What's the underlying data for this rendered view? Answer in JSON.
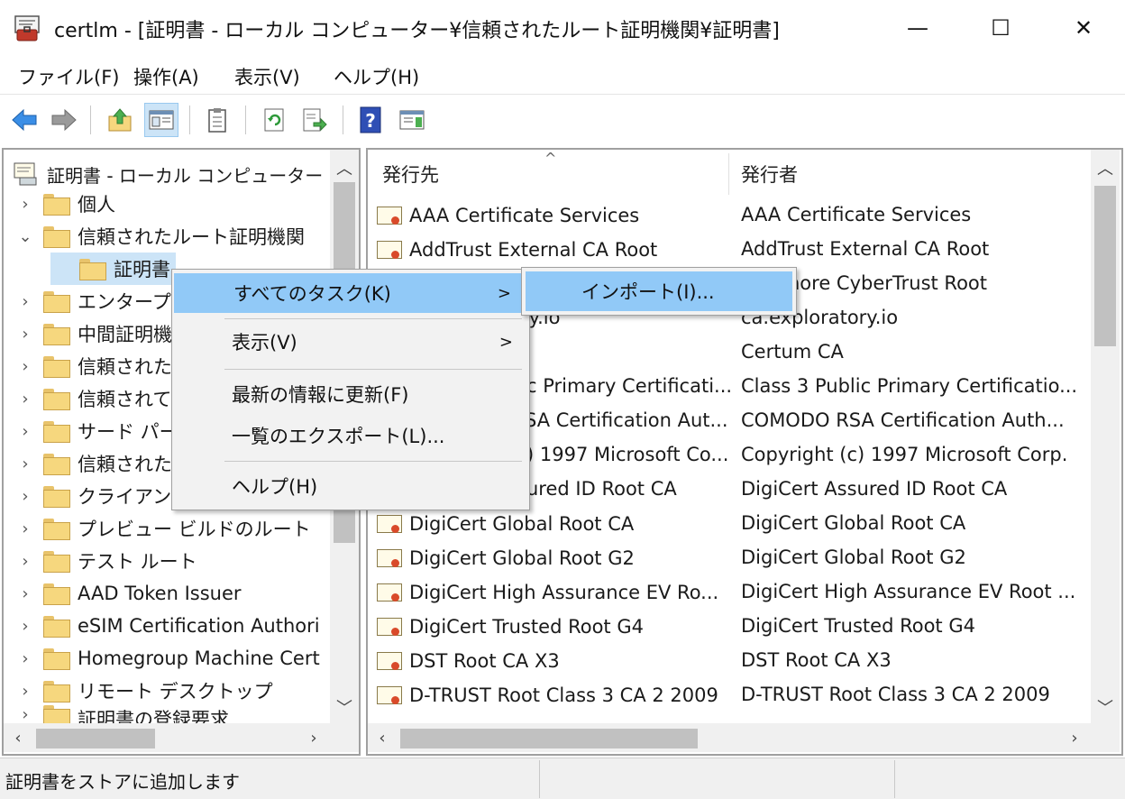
{
  "window": {
    "title": "certlm - [証明書 - ローカル コンピューター¥信頼されたルート証明機関¥証明書]",
    "min_glyph": "—",
    "max_glyph": "☐",
    "close_glyph": "✕"
  },
  "menu": [
    "ファイル(F)",
    "操作(A)",
    "表示(V)",
    "ヘルプ(H)"
  ],
  "toolbar": {
    "buttons": [
      "back-icon",
      "forward-icon",
      "up-folder-icon",
      "show-hide-console-tree-icon",
      "properties-icon",
      "refresh-icon",
      "export-list-icon",
      "help-icon",
      "action-pane-icon"
    ]
  },
  "tree": {
    "root": "証明書 - ローカル コンピューター",
    "items": [
      {
        "label": "個人",
        "chevron": ">"
      },
      {
        "label": "信頼されたルート証明機関",
        "chevron": "v"
      },
      {
        "label": "証明書",
        "chevron": ""
      },
      {
        "label": "エンタープライ",
        "chevron": ">"
      },
      {
        "label": "中間証明機",
        "chevron": ">"
      },
      {
        "label": "信頼された",
        "chevron": ">"
      },
      {
        "label": "信頼されて",
        "chevron": ">"
      },
      {
        "label": "サード パー",
        "chevron": ">"
      },
      {
        "label": "信頼された",
        "chevron": ">"
      },
      {
        "label": "クライアント",
        "chevron": ">"
      },
      {
        "label": "プレビュー ビルドのルート",
        "chevron": ">"
      },
      {
        "label": "テスト ルート",
        "chevron": ">"
      },
      {
        "label": "AAD Token Issuer",
        "chevron": ">"
      },
      {
        "label": "eSIM Certification Authori",
        "chevron": ">"
      },
      {
        "label": "Homegroup Machine Cert",
        "chevron": ">"
      },
      {
        "label": "リモート デスクトップ",
        "chevron": ">"
      },
      {
        "label": "証明書の登録要求",
        "chevron": ">"
      }
    ]
  },
  "list": {
    "col1": "発行先",
    "col2": "発行者",
    "sort_glyph": "^",
    "rows": [
      {
        "to": "AAA Certificate Services",
        "by": "AAA Certificate Services"
      },
      {
        "to": "AddTrust External CA Root",
        "by": "AddTrust External CA Root"
      },
      {
        "to": "",
        "by": "hore CyberTrust Root"
      },
      {
        "to": "ry.io",
        "by": "ca.exploratory.io"
      },
      {
        "to": "",
        "by": "Certum CA"
      },
      {
        "to": "c Primary Certificati...",
        "by": "Class 3 Public Primary Certificatio..."
      },
      {
        "to": "SA Certification Aut...",
        "by": "COMODO RSA Certification Auth..."
      },
      {
        "to": ") 1997 Microsoft Co...",
        "by": "Copyright (c) 1997 Microsoft Corp."
      },
      {
        "to": "ured ID Root CA",
        "by": "DigiCert Assured ID Root CA"
      },
      {
        "to": "DigiCert Global Root CA",
        "by": "DigiCert Global Root CA"
      },
      {
        "to": "DigiCert Global Root G2",
        "by": "DigiCert Global Root G2"
      },
      {
        "to": "DigiCert High Assurance EV Ro...",
        "by": "DigiCert High Assurance EV Root ..."
      },
      {
        "to": "DigiCert Trusted Root G4",
        "by": "DigiCert Trusted Root G4"
      },
      {
        "to": "DST Root CA X3",
        "by": "DST Root CA X3"
      },
      {
        "to": "D-TRUST Root Class 3 CA 2 2009",
        "by": "D-TRUST Root Class 3 CA 2 2009"
      }
    ]
  },
  "context_menu": {
    "items": [
      "すべてのタスク(K)",
      "表示(V)",
      "最新の情報に更新(F)",
      "一覧のエクスポート(L)...",
      "ヘルプ(H)"
    ],
    "submenu_arrow": ">"
  },
  "submenu": {
    "items": [
      "インポート(I)..."
    ]
  },
  "status": {
    "text": "証明書をストアに追加します"
  },
  "colors": {
    "highlight": "#91c9f7",
    "selected_toolbar": "#cce4f7"
  }
}
